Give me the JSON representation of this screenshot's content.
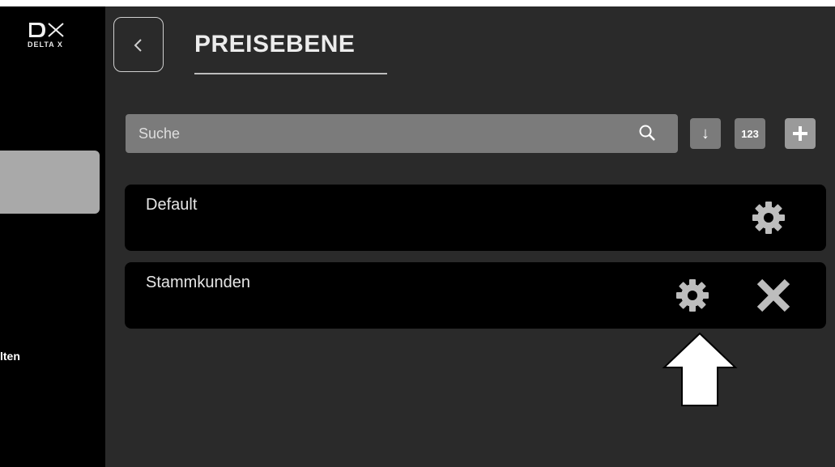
{
  "app": {
    "logo_text": "DELTA X",
    "sidebar_partial_label": "lten"
  },
  "header": {
    "title": "PREISEBENE"
  },
  "toolbar": {
    "search_placeholder": "Suche",
    "sort_label": "↓",
    "numeric_label": "123",
    "add_label": "+"
  },
  "list": {
    "items": [
      {
        "label": "Default",
        "actions": [
          "settings"
        ]
      },
      {
        "label": "Stammkunden",
        "actions": [
          "settings",
          "delete"
        ]
      }
    ]
  },
  "icons": {
    "back": "chevron-left-icon",
    "search": "search-icon",
    "settings": "gear-icon",
    "delete": "close-icon",
    "annotation": "up-arrow-icon"
  },
  "colors": {
    "background": "#2a2a2a",
    "sidebar": "#000000",
    "row": "#000000",
    "search": "#7b7b7b",
    "text": "#e6e6e6"
  }
}
